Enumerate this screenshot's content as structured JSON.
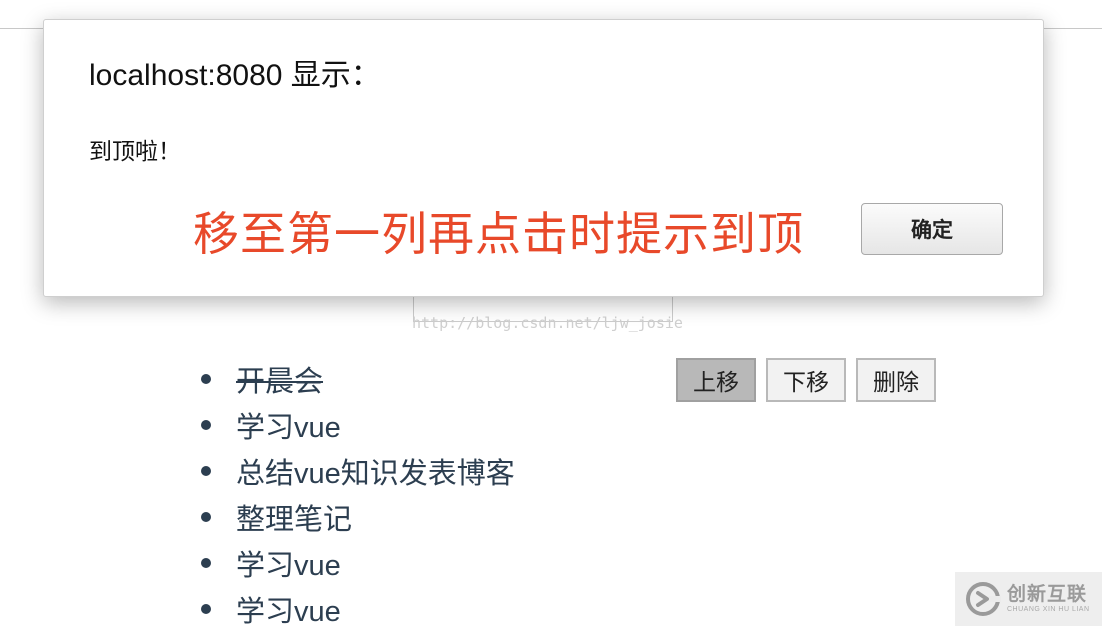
{
  "dialog": {
    "title": "localhost:8080 显示：",
    "message": "到顶啦！",
    "annotation": "移至第一列再点击时提示到顶",
    "ok_label": "确定"
  },
  "watermark": "http://blog.csdn.net/ljw_josie",
  "todos": [
    {
      "text": "开晨会",
      "done": true
    },
    {
      "text": "学习vue",
      "done": false
    },
    {
      "text": "总结vue知识发表博客",
      "done": false
    },
    {
      "text": "整理笔记",
      "done": false
    },
    {
      "text": "学习vue",
      "done": false
    },
    {
      "text": "学习vue",
      "done": false
    }
  ],
  "actions": {
    "move_up": "上移",
    "move_down": "下移",
    "delete": "删除"
  },
  "brand": {
    "name_cn": "创新互联",
    "name_en": "CHUANG XIN HU LIAN"
  },
  "colors": {
    "annotation": "#e8492a",
    "text": "#2c3e50"
  }
}
